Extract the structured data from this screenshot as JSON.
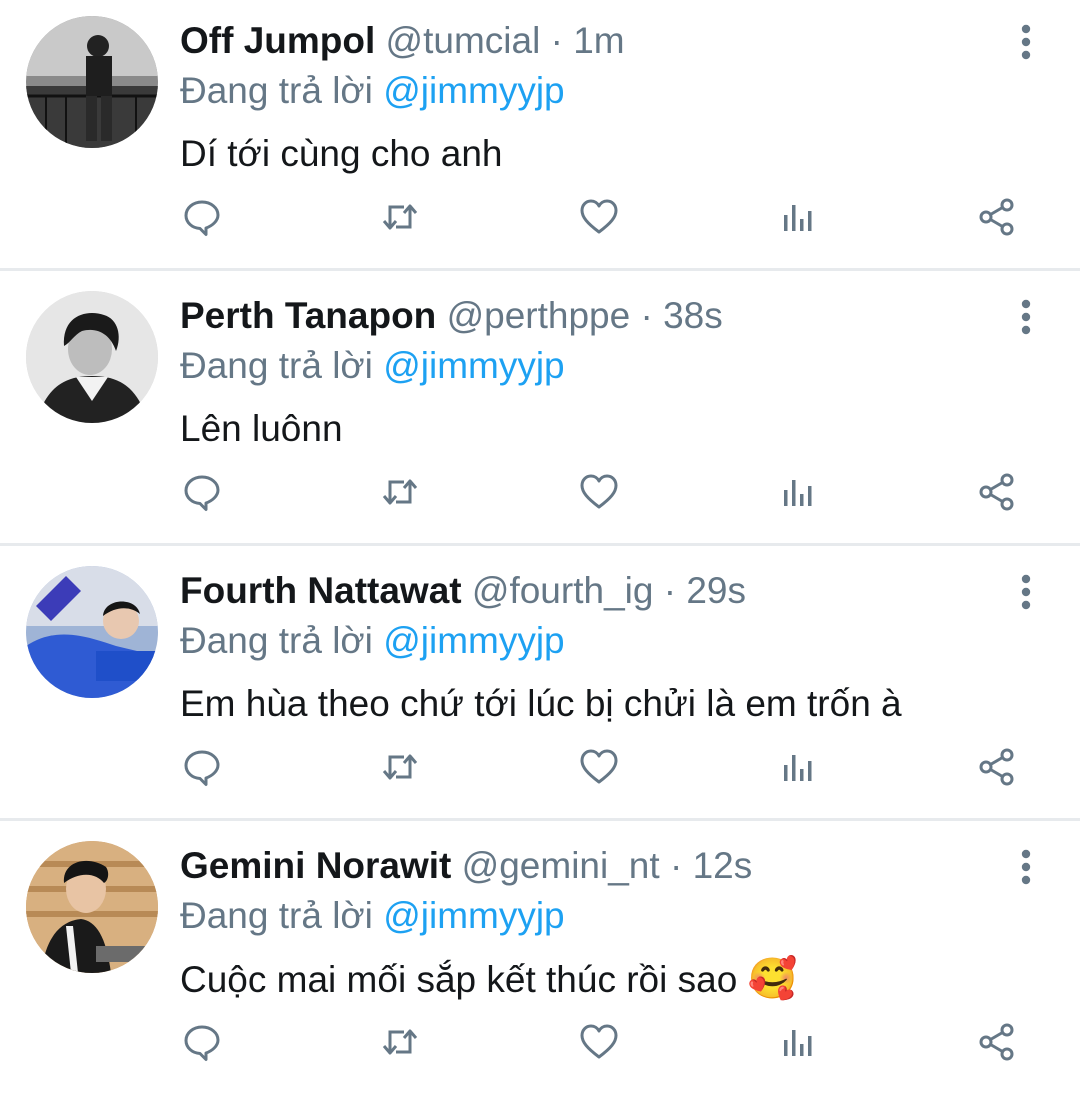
{
  "colors": {
    "accent": "#1da1f2",
    "secondary_text": "#657786",
    "primary_text": "#14171a",
    "divider": "#e7eaed"
  },
  "tweets": [
    {
      "name": "Off Jumpol",
      "handle": "@tumcial",
      "separator": "·",
      "time": "1m",
      "reply_prefix": "Đang trả lời",
      "reply_to": "@jimmyyjp",
      "text": "Dí tới cùng cho anh",
      "avatar_icon": "avatar-photo"
    },
    {
      "name": "Perth Tanapon",
      "handle": "@perthppe",
      "separator": "·",
      "time": "38s",
      "reply_prefix": "Đang trả lời",
      "reply_to": "@jimmyyjp",
      "text": "Lên luônn",
      "avatar_icon": "avatar-photo"
    },
    {
      "name": "Fourth Nattawat",
      "handle": "@fourth_ig",
      "separator": "·",
      "time": "29s",
      "reply_prefix": "Đang trả lời",
      "reply_to": "@jimmyyjp",
      "text": "Em hùa theo chứ tới lúc bị chửi là em trốn à",
      "avatar_icon": "avatar-photo"
    },
    {
      "name": "Gemini Norawit",
      "handle": "@gemini_nt",
      "separator": "·",
      "time": "12s",
      "reply_prefix": "Đang trả lời",
      "reply_to": "@jimmyyjp",
      "text": "Cuộc mai mối sắp kết thúc rồi sao",
      "emoji": "🥰",
      "avatar_icon": "avatar-photo"
    }
  ],
  "action_icons": [
    "reply-icon",
    "retweet-icon",
    "like-icon",
    "analytics-icon",
    "share-icon"
  ],
  "menu_icon": "more-options-icon"
}
